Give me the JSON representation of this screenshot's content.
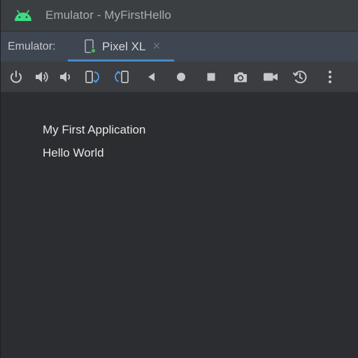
{
  "window": {
    "title": "Emulator - MyFirstHello",
    "app_icon": "android-icon"
  },
  "tabbar": {
    "label": "Emulator:",
    "tabs": [
      {
        "label": "Pixel XL",
        "icon": "device-icon",
        "active": true
      }
    ]
  },
  "toolbar": {
    "buttons": [
      {
        "name": "power-icon"
      },
      {
        "name": "volume-up-icon"
      },
      {
        "name": "volume-down-icon"
      },
      {
        "name": "rotate-left-icon"
      },
      {
        "name": "rotate-right-icon"
      },
      {
        "name": "back-icon"
      },
      {
        "name": "home-icon"
      },
      {
        "name": "overview-icon"
      },
      {
        "name": "camera-icon"
      },
      {
        "name": "screen-record-icon"
      },
      {
        "name": "snapshot-icon"
      },
      {
        "name": "more-icon"
      }
    ],
    "accent": "#4a88c7"
  },
  "screen": {
    "app_title": "My First Application",
    "content": "Hello World"
  }
}
